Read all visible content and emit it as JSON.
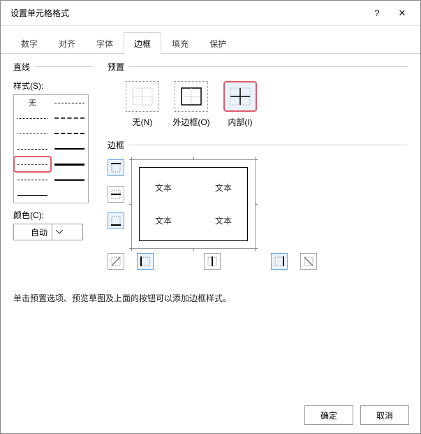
{
  "window": {
    "title": "设置单元格格式",
    "help": "?",
    "close": "✕"
  },
  "tabs": {
    "items": [
      {
        "label": "数字"
      },
      {
        "label": "对齐"
      },
      {
        "label": "字体"
      },
      {
        "label": "边框"
      },
      {
        "label": "填充"
      },
      {
        "label": "保护"
      }
    ],
    "active_index": 3
  },
  "line": {
    "legend": "直线",
    "style_label": "样式(S):",
    "none_label": "无",
    "color_label": "颜色(C):",
    "color_value": "自动"
  },
  "presets": {
    "legend": "预置",
    "items": [
      {
        "label": "无(N)"
      },
      {
        "label": "外边框(O)"
      },
      {
        "label": "内部(I)"
      }
    ],
    "selected_index": 2
  },
  "border": {
    "legend": "边框",
    "preview_text": "文本"
  },
  "hint": "单击预置选项、预览草图及上面的按钮可以添加边框样式。",
  "buttons": {
    "ok": "确定",
    "cancel": "取消"
  }
}
